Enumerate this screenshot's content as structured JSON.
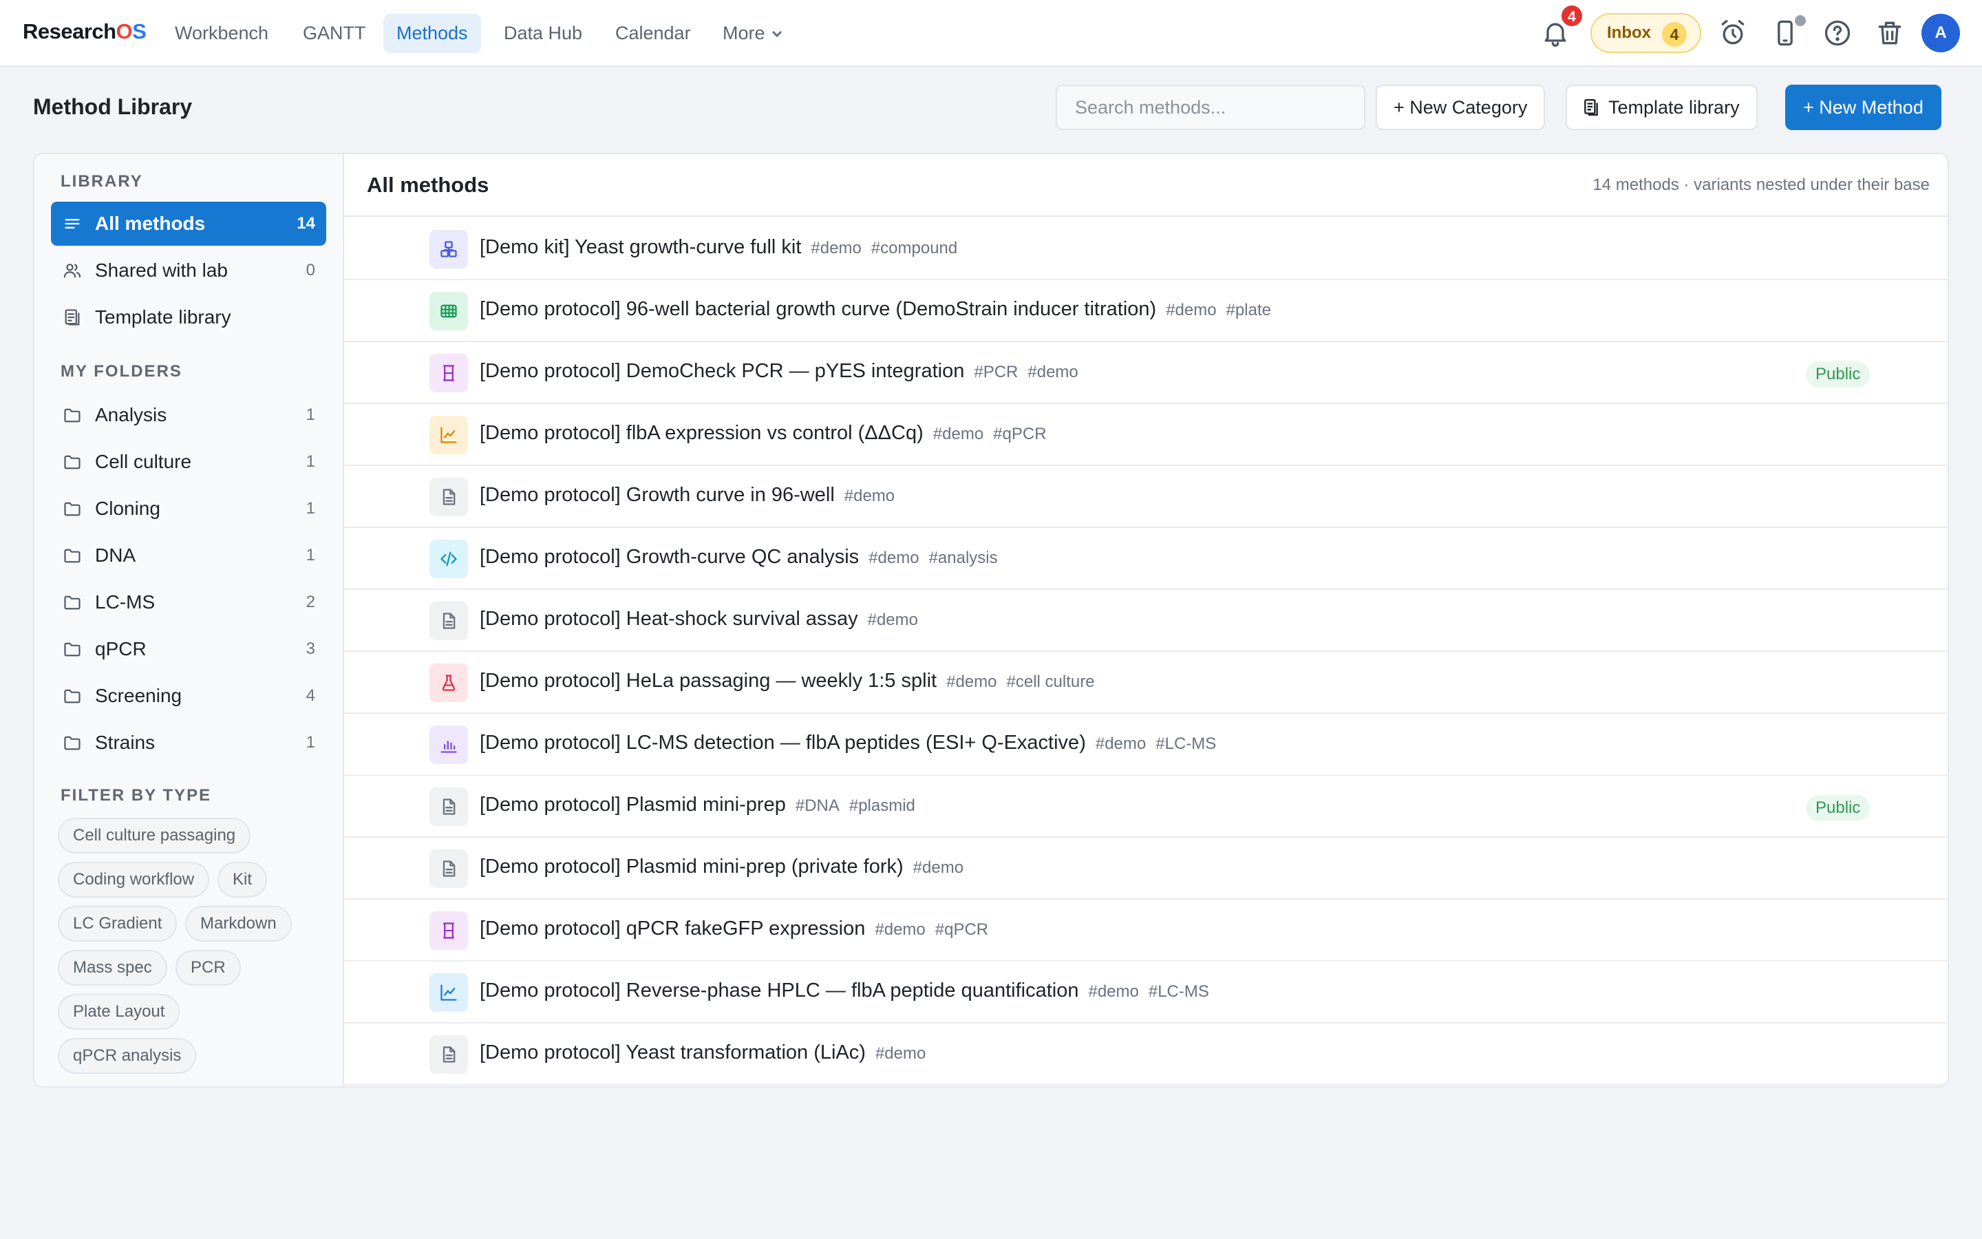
{
  "app": {
    "logo_prefix": "Research",
    "logo_o": "O",
    "logo_s": "S"
  },
  "nav": {
    "items": [
      {
        "label": "Workbench"
      },
      {
        "label": "GANTT"
      },
      {
        "label": "Methods"
      },
      {
        "label": "Data Hub"
      },
      {
        "label": "Calendar"
      },
      {
        "label": "More"
      }
    ],
    "active": "Methods"
  },
  "topbar": {
    "notifications_count": "4",
    "inbox_label": "Inbox",
    "inbox_count": "4",
    "avatar_initial": "A",
    "icons": [
      "bell-icon",
      "alarm-icon",
      "phone-icon",
      "help-icon",
      "trash-icon"
    ]
  },
  "header": {
    "title": "Method Library",
    "search_placeholder": "Search methods...",
    "new_category_label": "+ New Category",
    "template_library_label": "Template library",
    "new_method_label": "+ New Method"
  },
  "sidebar": {
    "library_title": "LIBRARY",
    "library_items": [
      {
        "label": "All methods",
        "count": "14",
        "icon": "list-icon"
      },
      {
        "label": "Shared with lab",
        "count": "0",
        "icon": "users-icon"
      },
      {
        "label": "Template library",
        "count": "",
        "icon": "template-icon"
      }
    ],
    "folders_title": "MY FOLDERS",
    "folders": [
      {
        "label": "Analysis",
        "count": "1"
      },
      {
        "label": "Cell culture",
        "count": "1"
      },
      {
        "label": "Cloning",
        "count": "1"
      },
      {
        "label": "DNA",
        "count": "1"
      },
      {
        "label": "LC-MS",
        "count": "2"
      },
      {
        "label": "qPCR",
        "count": "3"
      },
      {
        "label": "Screening",
        "count": "4"
      },
      {
        "label": "Strains",
        "count": "1"
      }
    ],
    "filter_title": "FILTER BY TYPE",
    "filters": [
      "Cell culture passaging",
      "Coding workflow",
      "Kit",
      "LC Gradient",
      "Markdown",
      "Mass spec",
      "PCR",
      "Plate Layout",
      "qPCR analysis"
    ]
  },
  "list": {
    "title": "All methods",
    "meta": "14 methods · variants nested under their base",
    "public_label": "Public",
    "rows": [
      {
        "title": "[Demo kit] Yeast growth-curve full kit",
        "tags": [
          "#demo",
          "#compound"
        ],
        "icon": "kit-icon",
        "icon_bg": "#e9eafd",
        "icon_color": "#4f5bd5",
        "public": false
      },
      {
        "title": "[Demo protocol] 96-well bacterial growth curve (DemoStrain inducer titration)",
        "tags": [
          "#demo",
          "#plate"
        ],
        "icon": "plate-icon",
        "icon_bg": "#dcf5e7",
        "icon_color": "#1f9d5c",
        "public": false
      },
      {
        "title": "[Demo protocol] DemoCheck PCR — pYES integration",
        "tags": [
          "#PCR",
          "#demo"
        ],
        "icon": "hourglass-icon",
        "icon_bg": "#f5e6fb",
        "icon_color": "#a033c9",
        "public": true
      },
      {
        "title": "[Demo protocol] flbA expression vs control (ΔΔCq)",
        "tags": [
          "#demo",
          "#qPCR"
        ],
        "icon": "chart-line-icon",
        "icon_bg": "#fdf0d6",
        "icon_color": "#d9870a",
        "public": false
      },
      {
        "title": "[Demo protocol] Growth curve in 96-well",
        "tags": [
          "#demo"
        ],
        "icon": "document-icon",
        "icon_bg": "#f0f1f3",
        "icon_color": "#6b7280",
        "public": false
      },
      {
        "title": "[Demo protocol] Growth-curve QC analysis",
        "tags": [
          "#demo",
          "#analysis"
        ],
        "icon": "code-icon",
        "icon_bg": "#dcf4fb",
        "icon_color": "#1598c4",
        "public": false
      },
      {
        "title": "[Demo protocol] Heat-shock survival assay",
        "tags": [
          "#demo"
        ],
        "icon": "document-icon",
        "icon_bg": "#f0f1f3",
        "icon_color": "#6b7280",
        "public": false
      },
      {
        "title": "[Demo protocol] HeLa passaging — weekly 1:5 split",
        "tags": [
          "#demo",
          "#cell culture"
        ],
        "icon": "flask-icon",
        "icon_bg": "#fde5e7",
        "icon_color": "#e0344d",
        "public": false
      },
      {
        "title": "[Demo protocol] LC-MS detection — flbA peptides (ESI+ Q-Exactive)",
        "tags": [
          "#demo",
          "#LC-MS"
        ],
        "icon": "bar-chart-icon",
        "icon_bg": "#efe7fc",
        "icon_color": "#7b4ee0",
        "public": false
      },
      {
        "title": "[Demo protocol] Plasmid mini-prep",
        "tags": [
          "#DNA",
          "#plasmid"
        ],
        "icon": "document-icon",
        "icon_bg": "#f0f1f3",
        "icon_color": "#6b7280",
        "public": true
      },
      {
        "title": "[Demo protocol] Plasmid mini-prep (private fork)",
        "tags": [
          "#demo"
        ],
        "icon": "document-icon",
        "icon_bg": "#f0f1f3",
        "icon_color": "#6b7280",
        "public": false
      },
      {
        "title": "[Demo protocol] qPCR fakeGFP expression",
        "tags": [
          "#demo",
          "#qPCR"
        ],
        "icon": "hourglass-icon",
        "icon_bg": "#f5e6fb",
        "icon_color": "#a033c9",
        "public": false
      },
      {
        "title": "[Demo protocol] Reverse-phase HPLC — flbA peptide quantification",
        "tags": [
          "#demo",
          "#LC-MS"
        ],
        "icon": "chart-line-icon",
        "icon_bg": "#def0fb",
        "icon_color": "#1f7fd0",
        "public": false
      },
      {
        "title": "[Demo protocol] Yeast transformation (LiAc)",
        "tags": [
          "#demo"
        ],
        "icon": "document-icon",
        "icon_bg": "#f0f1f3",
        "icon_color": "#6b7280",
        "public": false
      }
    ]
  }
}
